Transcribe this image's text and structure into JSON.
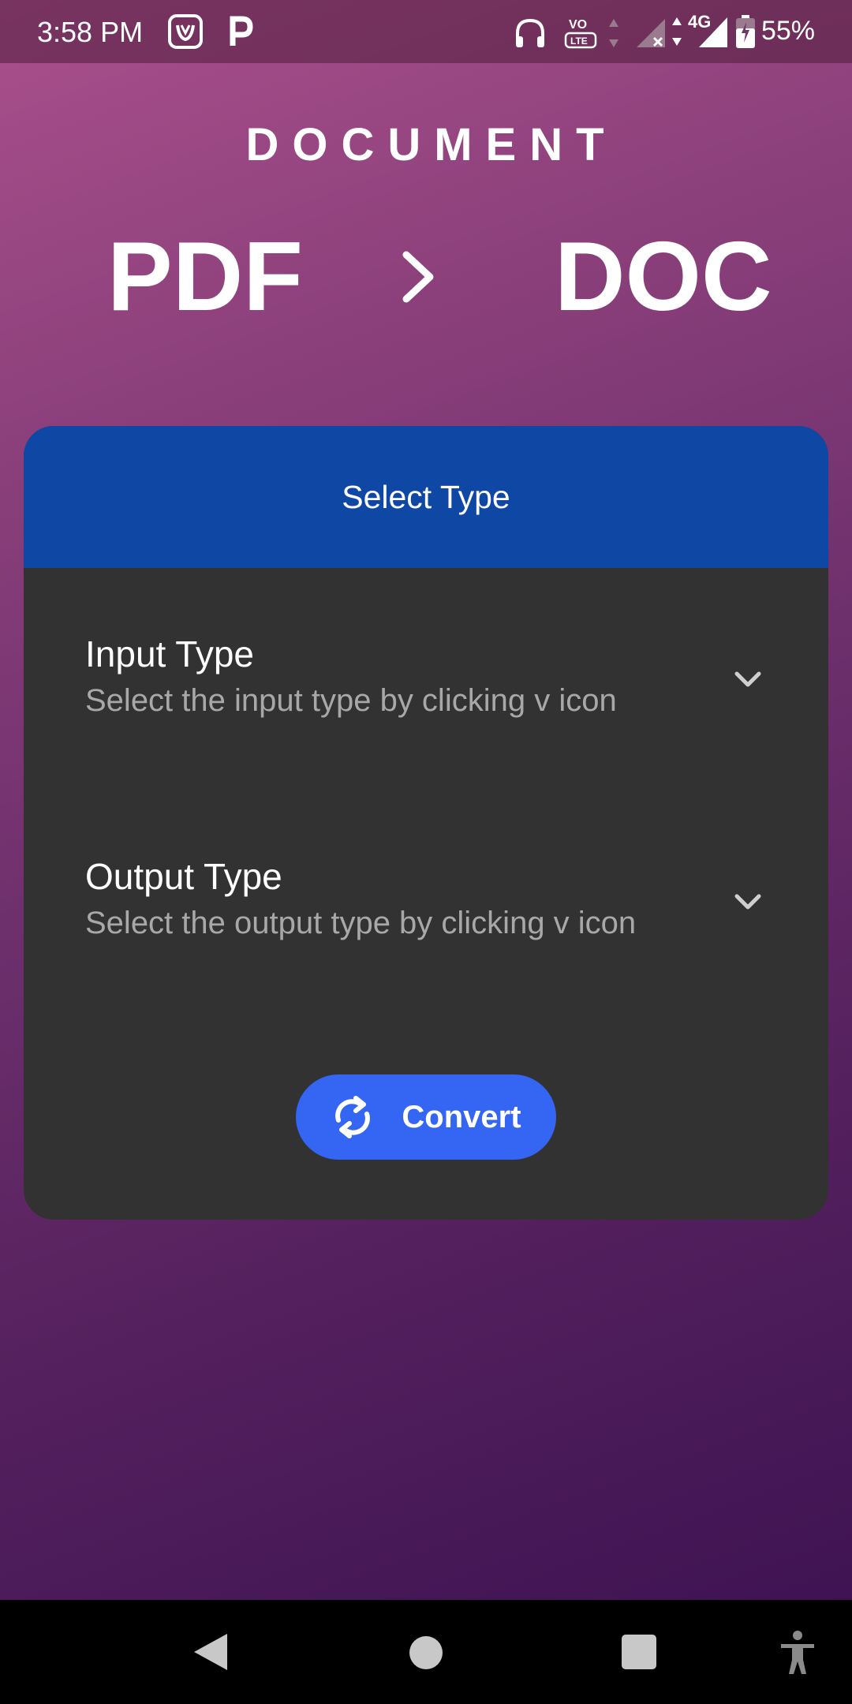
{
  "status_bar": {
    "time": "3:58 PM",
    "battery": "55%",
    "network": "4G"
  },
  "header": {
    "title": "DOCUMENT",
    "from_format": "PDF",
    "to_format": "DOC"
  },
  "card": {
    "title": "Select Type",
    "input": {
      "label": "Input Type",
      "hint": "Select the input type by clicking ᴠ icon"
    },
    "output": {
      "label": "Output Type",
      "hint": "Select the output type by clicking ᴠ icon"
    },
    "convert_label": "Convert"
  },
  "colors": {
    "card_header": "#0e48a4",
    "card_body": "#323232",
    "convert_button": "#3566f3",
    "gradient_top": "#a9508c",
    "gradient_bottom": "#3f1352"
  },
  "icons": [
    "headphones-icon",
    "volte-icon",
    "signal-icon",
    "battery-icon",
    "chevron-right-icon",
    "chevron-down-icon",
    "sync-icon",
    "back-icon",
    "home-icon",
    "recents-icon",
    "accessibility-icon"
  ]
}
